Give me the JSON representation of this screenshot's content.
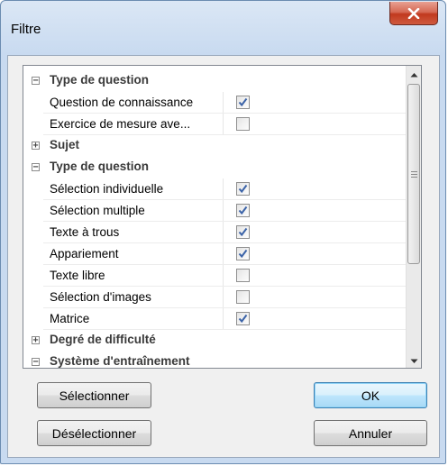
{
  "window": {
    "title": "Filtre"
  },
  "list": {
    "rows": [
      {
        "type": "category",
        "expanded": true,
        "label": "Type de question"
      },
      {
        "type": "item",
        "label": "Question de connaissance",
        "checked": true
      },
      {
        "type": "item",
        "label": "Exercice de mesure ave...",
        "checked": false
      },
      {
        "type": "category",
        "expanded": false,
        "label": "Sujet"
      },
      {
        "type": "category",
        "expanded": true,
        "label": "Type de question"
      },
      {
        "type": "item",
        "label": "Sélection individuelle",
        "checked": true
      },
      {
        "type": "item",
        "label": "Sélection multiple",
        "checked": true
      },
      {
        "type": "item",
        "label": "Texte à trous",
        "checked": true
      },
      {
        "type": "item",
        "label": "Appariement",
        "checked": true
      },
      {
        "type": "item",
        "label": "Texte libre",
        "checked": false
      },
      {
        "type": "item",
        "label": "Sélection d'images",
        "checked": false
      },
      {
        "type": "item",
        "label": "Matrice",
        "checked": true
      },
      {
        "type": "category",
        "expanded": false,
        "label": "Degré de difficulté"
      },
      {
        "type": "category",
        "expanded": true,
        "label": "Système d'entraînement"
      }
    ]
  },
  "buttons": {
    "select_all": "Sélectionner",
    "deselect_all": "Désélectionner",
    "ok": "OK",
    "cancel": "Annuler"
  },
  "colors": {
    "close_button": "#c1391e",
    "check_mark": "#3b63a8",
    "default_button_border": "#3c7fb1"
  }
}
